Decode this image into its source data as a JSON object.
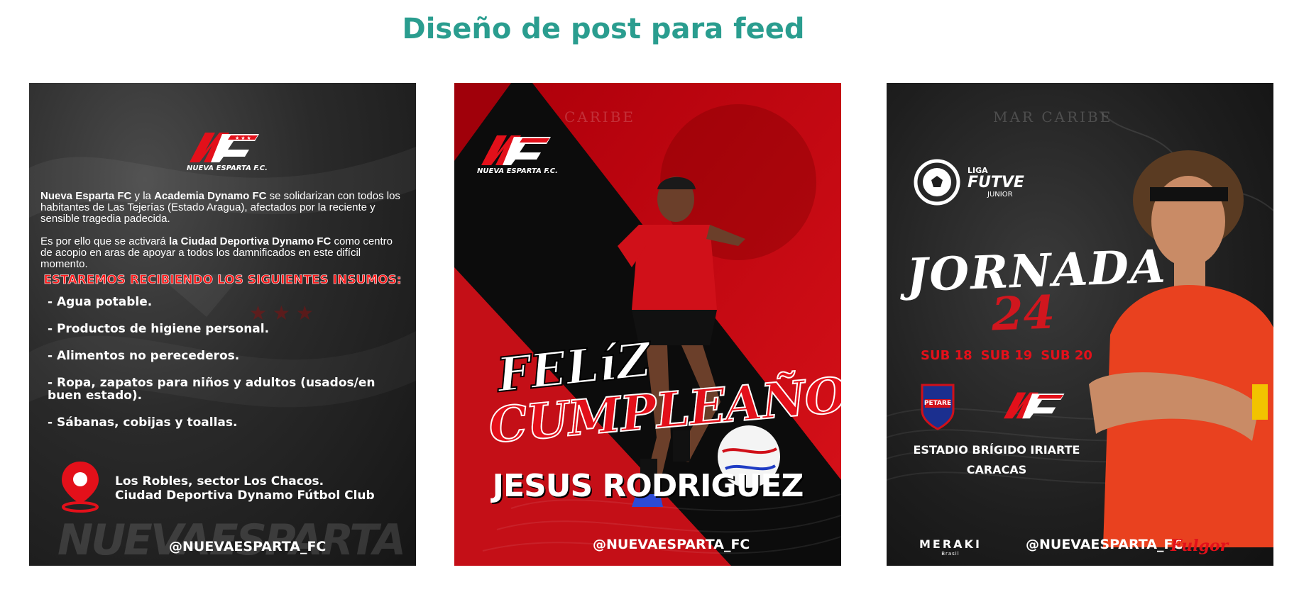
{
  "page": {
    "title": "Diseño de post para feed"
  },
  "logo": {
    "caption": "NUEVA ESPARTA F.C."
  },
  "post1": {
    "para1_bold_a": "Nueva Esparta FC",
    "para1_mid": " y la ",
    "para1_bold_b": "Academia Dynamo FC",
    "para1_rest": "  se solidarizan con todos los habitantes de Las Tejerías (Estado Aragua), afectados por la reciente y sensible tragedia padecida.",
    "para2_start": "Es por ello que se activará ",
    "para2_bold": "la Ciudad Deportiva Dynamo FC",
    "para2_rest": " como centro de acopio en aras de apoyar a todos los damnificados en este difícil momento.",
    "heading": "ESTAREMOS RECIBIENDO LOS SIGUIENTES INSUMOS:",
    "items": [
      "- Agua potable.",
      "- Productos de higiene personal.",
      "- Alimentos no perecederos.",
      "- Ropa, zapatos para niños y adultos (usados/en buen estado).",
      "- Sábanas, cobijas y toallas."
    ],
    "address_line1": "Los Robles, sector Los Chacos.",
    "address_line2": "Ciudad Deportiva Dynamo Fútbol Club",
    "watermark": "NUEVAESPARTA F.C",
    "handle": "@NUEVAESPARTA_FC"
  },
  "post2": {
    "title_line1": "FELíZ",
    "title_line2": "CUMPLEAÑOS",
    "player_name": "JESUS RODRIGUEZ",
    "map_label": "CARIBE",
    "handle": "@NUEVAESPARTA_FC"
  },
  "post3": {
    "league_small": "LIGA",
    "league_big": "FUTVE",
    "league_sub": "JUNIOR",
    "map_label": "MAR CARIBE",
    "jornada_label": "JORNADA",
    "jornada_number": "24",
    "categories": [
      "SUB 18",
      "SUB 19",
      "SUB 20"
    ],
    "opponent_badge": "PETARE",
    "venue_line1": "ESTADIO BRÍGIDO IRIARTE",
    "venue_line2": "CARACAS",
    "sponsor1": "MERAKI",
    "sponsor1_sub": "Brasil",
    "handle": "@NUEVAESPARTA_FC",
    "sponsor2": "Fulgor"
  },
  "colors": {
    "title_teal": "#2a9d8f",
    "brand_red": "#e3101a",
    "dark": "#0d0d0d"
  },
  "icons": [
    "nueva-esparta-logo",
    "location-pin-icon",
    "futve-ball-icon",
    "petare-crest"
  ]
}
